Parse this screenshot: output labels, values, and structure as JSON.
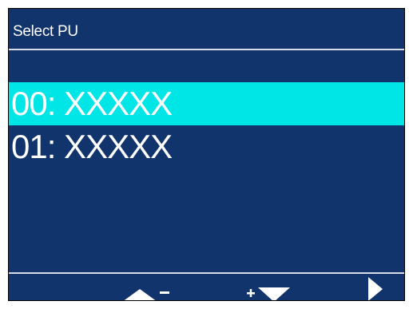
{
  "header": {
    "title": "Select PU"
  },
  "list": {
    "items": [
      {
        "label": "00: XXXXX",
        "selected": true
      },
      {
        "label": "01: XXXXX",
        "selected": false
      }
    ]
  },
  "softkeys": [
    {
      "icon": "up-minus-icon"
    },
    {
      "icon": "plus-down-icon"
    },
    {
      "icon": "right-arrow-icon"
    }
  ],
  "colors": {
    "background": "#12346c",
    "highlight": "#00e5e5",
    "divider": "#d6dbe6",
    "text": "#ffffff"
  }
}
